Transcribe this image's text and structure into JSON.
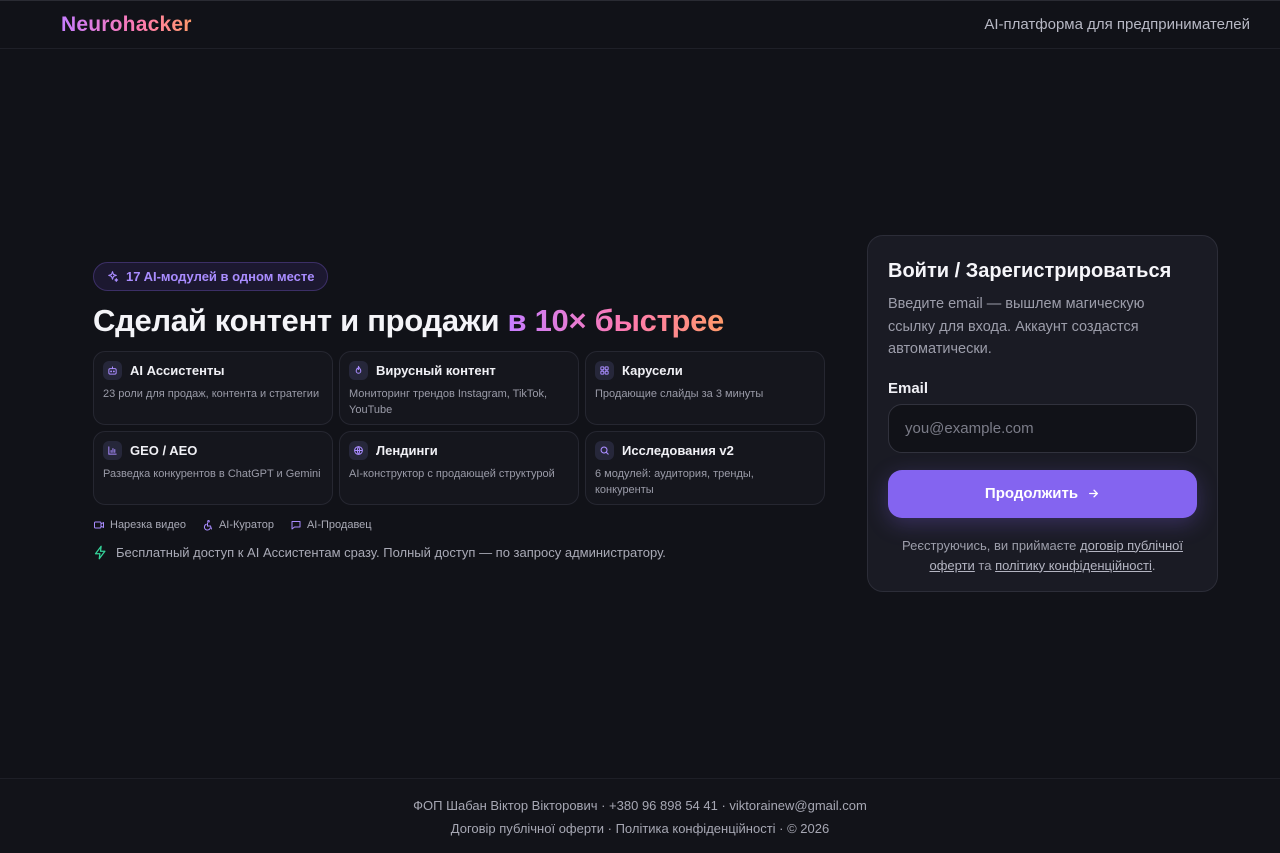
{
  "header": {
    "logo": "Neurohacker",
    "tagline": "AI-платформа для предпринимателей"
  },
  "hero": {
    "badge": "17 AI-модулей в одном месте",
    "title_main": "Сделай контент и продажи ",
    "title_accent": "в 10× быстрее",
    "cards": [
      {
        "title": "AI Ассистенты",
        "desc": "23 роли для продаж, контента и стратегии",
        "icon": "bot-icon"
      },
      {
        "title": "Вирусный контент",
        "desc": "Мониторинг трендов Instagram, TikTok, YouTube",
        "icon": "flame-icon"
      },
      {
        "title": "Карусели",
        "desc": "Продающие слайды за 3 минуты",
        "icon": "grid-icon"
      },
      {
        "title": "GEO / AEO",
        "desc": "Разведка конкурентов в ChatGPT и Gemini",
        "icon": "bar-chart-icon"
      },
      {
        "title": "Лендинги",
        "desc": "AI-конструктор с продающей структурой",
        "icon": "globe-icon"
      },
      {
        "title": "Исследования v2",
        "desc": "6 модулей: аудитория, тренды, конкуренты",
        "icon": "search-icon"
      }
    ],
    "extras": [
      {
        "label": "Нарезка видео",
        "icon": "video-icon"
      },
      {
        "label": "AI-Куратор",
        "icon": "accessibility-icon"
      },
      {
        "label": "AI-Продавец",
        "icon": "chat-icon"
      }
    ],
    "free_note": "Бесплатный доступ к AI Ассистентам сразу. Полный доступ — по запросу администратору."
  },
  "auth": {
    "title": "Войти / Зарегистрироваться",
    "desc": "Введите email — вышлем магическую ссылку для входа. Аккаунт создастся автоматически.",
    "email_label": "Email",
    "email_placeholder": "you@example.com",
    "email_value": "",
    "submit_label": "Продолжить",
    "terms_prefix": "Реєструючись, ви приймаєте ",
    "terms_link1": "договір публічної оферти",
    "terms_mid": " та ",
    "terms_link2": "політику конфіденційності",
    "terms_suffix": "."
  },
  "footer": {
    "line1": "ФОП Шабан Віктор Вікторович · +380 96 898 54 41 · viktorainew@gmail.com",
    "link_offer": "Договір публічної оферти",
    "sep1": " · ",
    "link_privacy": "Політика конфіденційності",
    "copyright": " · © 2026"
  },
  "colors": {
    "background": "#111218",
    "accent": "#8464f0",
    "gradient_start": "#c77dff",
    "gradient_end": "#ff9a6a",
    "success_icon": "#34d399"
  }
}
